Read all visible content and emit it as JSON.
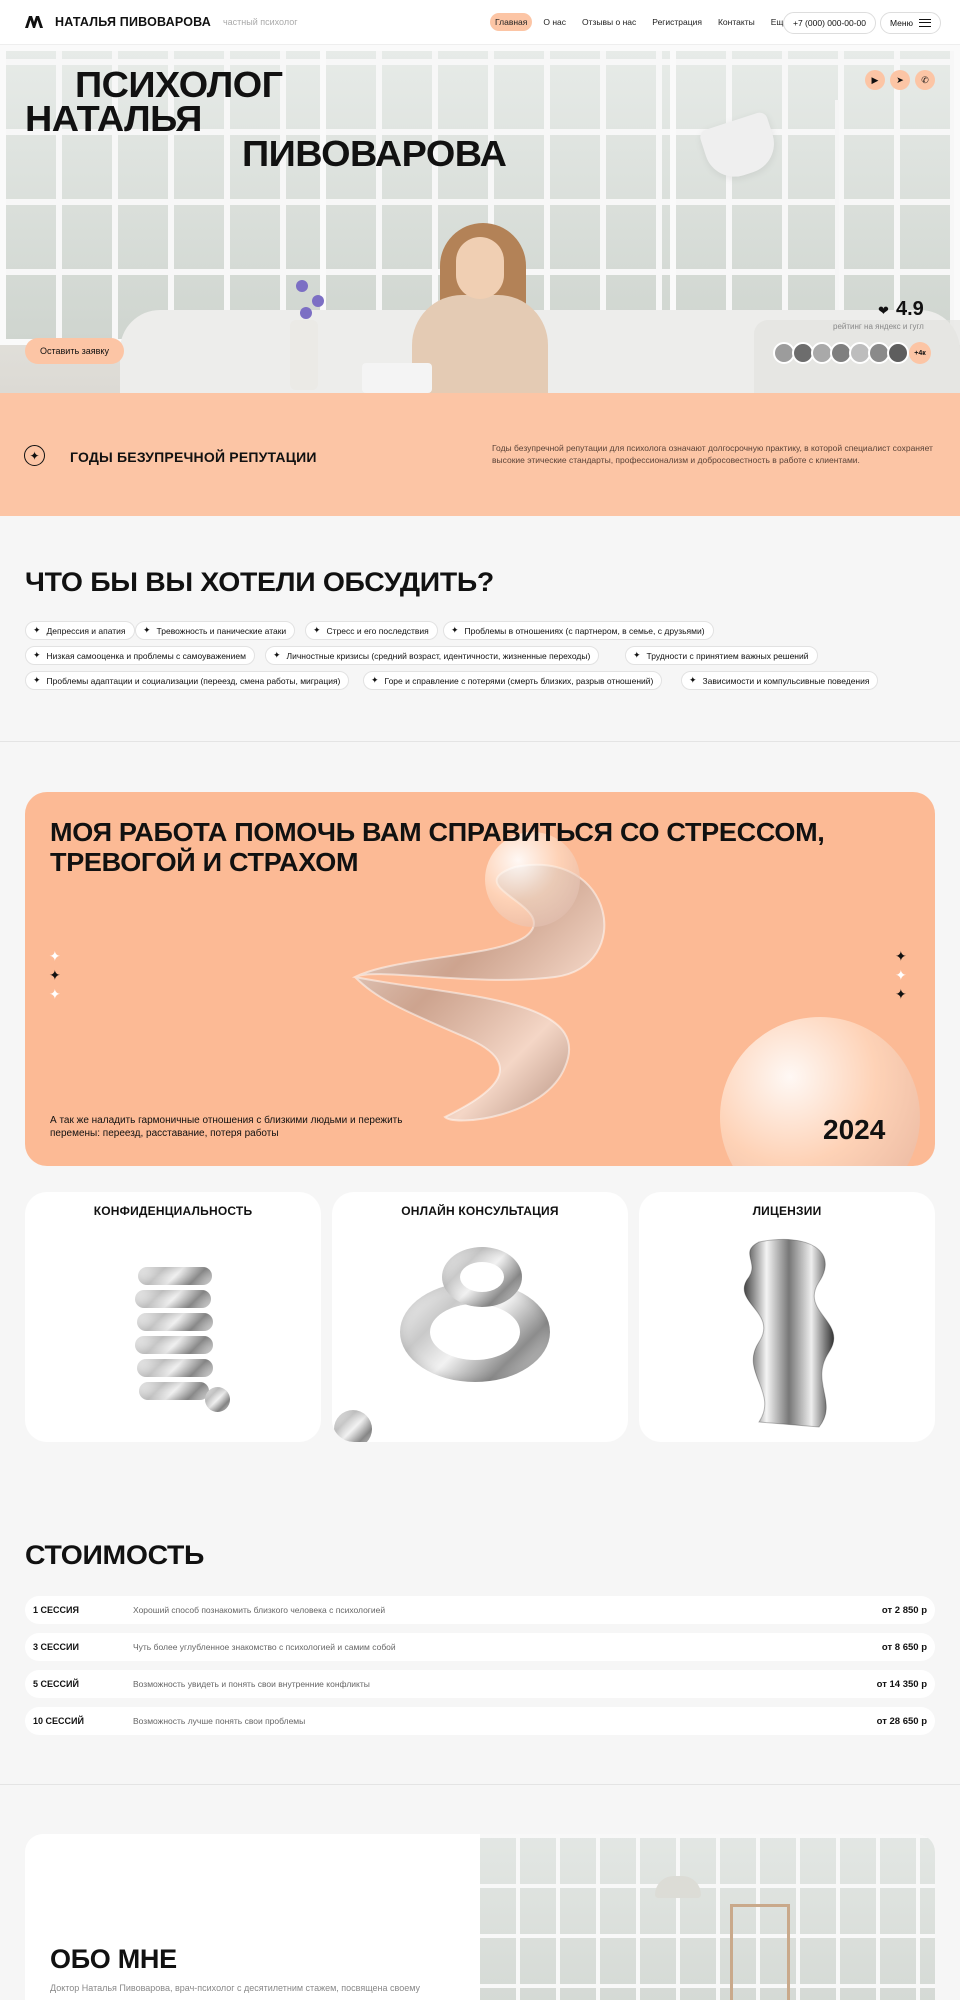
{
  "header": {
    "brand": "НАТАЛЬЯ ПИВОВАРОВА",
    "subtitle": "частный психолог",
    "nav": [
      "Главная",
      "О нас",
      "Отзывы о нас",
      "Регистрация",
      "Контакты",
      "Еще"
    ],
    "phone": "+7 (000) 000-00-00",
    "menu": "Меню"
  },
  "hero": {
    "line1": "ПСИХОЛОГ",
    "line2": "НАТАЛЬЯ",
    "line3": "ПИВОВАРОВА",
    "cta": "Оставить заявку",
    "rating": "4.9",
    "rating_label": "рейтинг на яндекс и гугл",
    "avatars_more": "+4к",
    "social_icons": [
      "youtube-icon",
      "telegram-icon",
      "whatsapp-icon"
    ],
    "accent_color": "#fcc5a5"
  },
  "band": {
    "title": "ГОДЫ БЕЗУПРЕЧНОЙ РЕПУТАЦИИ",
    "text": "Годы безупречной репутации для психолога означают долгосрочную практику, в которой специалист сохраняет высокие этические стандарты, профессионализм и добросовестность в работе с клиентами."
  },
  "topics": {
    "title": "ЧТО БЫ ВЫ ХОТЕЛИ ОБСУДИТЬ?",
    "items": [
      "Депрессия и апатия",
      "Тревожность и панические атаки",
      "Стресс и его последствия",
      "Проблемы в отношениях (с партнером, в семье, с друзьями)",
      "Низкая самооценка и проблемы с самоуважением",
      "Личностные кризисы (средний возраст, идентичности, жизненные переходы)",
      "Трудности с принятием важных решений",
      "Проблемы адаптации и социализации (переезд, смена работы, миграция)",
      "Горе и справление с потерями (смерть близких, разрыв отношений)",
      "Зависимости и компульсивные поведения"
    ]
  },
  "work": {
    "title": "МОЯ РАБОТА ПОМОЧЬ ВАМ СПРАВИТЬСЯ СО СТРЕССОМ, ТРЕВОГОЙ И СТРАХОМ",
    "text": "А так же наладить гармоничные отношения с близкими людьми и пережить перемены: переезд, расставание, потеря работы",
    "year": "2024"
  },
  "features": [
    "КОНФИДЕНЦИАЛЬНОСТЬ",
    "ОНЛАЙН КОНСУЛЬТАЦИЯ",
    "ЛИЦЕНЗИИ"
  ],
  "pricing": {
    "title": "СТОИМОСТЬ",
    "rows": [
      {
        "name": "1 СЕССИЯ",
        "desc": "Хороший способ познакомить близкого человека с психологией",
        "price": "от 2 850 р"
      },
      {
        "name": "3 СЕССИИ",
        "desc": "Чуть более углубленное знакомство с психологией и самим собой",
        "price": "от 8 650 р"
      },
      {
        "name": "5 СЕССИЙ",
        "desc": "Возможность увидеть и понять свои внутренние конфликты",
        "price": "от 14 350 р"
      },
      {
        "name": "10 СЕССИЙ",
        "desc": "Возможность лучше понять свои проблемы",
        "price": "от 28 650 р"
      }
    ]
  },
  "about": {
    "title": "ОБО МНЕ",
    "text": "Доктор Наталья Пивоварова, врач-психолог с десятилетним стажем, посвящена своему"
  }
}
